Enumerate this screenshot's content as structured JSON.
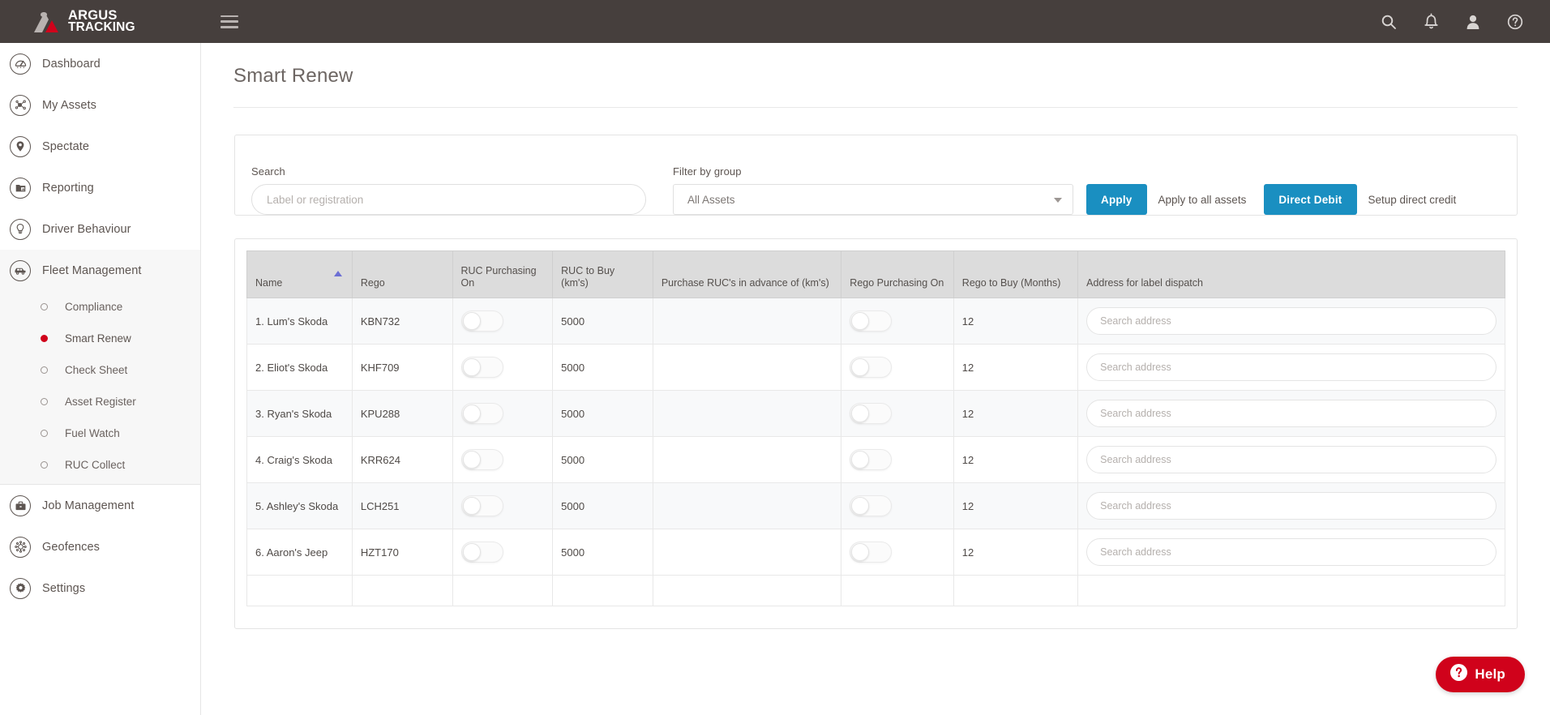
{
  "brand": {
    "name_line1": "ARGUS",
    "name_line2": "TRACKING",
    "red": "#d0021b",
    "gray": "#b8b2b0",
    "header_bg": "#463f3d"
  },
  "topbar": {
    "hamburger_name": "menu-toggle",
    "icons": [
      {
        "name": "search-icon",
        "label": "Search"
      },
      {
        "name": "bell-icon",
        "label": "Notifications"
      },
      {
        "name": "user-icon",
        "label": "Account"
      },
      {
        "name": "help-circle-icon",
        "label": "Help"
      }
    ]
  },
  "sidebar": {
    "items": [
      {
        "label": "Dashboard",
        "icon": "dashboard-icon",
        "key": "dashboard"
      },
      {
        "label": "My Assets",
        "icon": "assets-icon",
        "key": "my-assets"
      },
      {
        "label": "Spectate",
        "icon": "map-pin-icon",
        "key": "spectate"
      },
      {
        "label": "Reporting",
        "icon": "report-icon",
        "key": "reporting"
      },
      {
        "label": "Driver Behaviour",
        "icon": "bulb-icon",
        "key": "driver-behaviour"
      },
      {
        "label": "Fleet Management",
        "icon": "truck-icon",
        "key": "fleet-management"
      }
    ],
    "fleet_sub_items": [
      {
        "label": "Compliance",
        "selected": false
      },
      {
        "label": "Smart Renew",
        "selected": true
      },
      {
        "label": "Check Sheet",
        "selected": false
      },
      {
        "label": "Asset Register",
        "selected": false
      },
      {
        "label": "Fuel Watch",
        "selected": false
      },
      {
        "label": "RUC Collect",
        "selected": false
      }
    ],
    "bottom_items": [
      {
        "label": "Job Management",
        "icon": "briefcase-icon",
        "key": "job-management"
      },
      {
        "label": "Geofences",
        "icon": "geofence-icon",
        "key": "geofences"
      },
      {
        "label": "Settings",
        "icon": "gear-icon",
        "key": "settings"
      }
    ]
  },
  "page": {
    "title": "Smart Renew"
  },
  "filters": {
    "search_label": "Search",
    "search_placeholder": "Label or registration",
    "search_value": "",
    "group_label": "Filter by group",
    "group_value": "All Assets",
    "apply_button": "Apply",
    "apply_hint": "Apply to all assets",
    "direct_debit_button": "Direct Debit",
    "direct_debit_hint": "Setup direct credit",
    "accent": "#1a8fc1"
  },
  "table": {
    "columns": [
      "Name",
      "Rego",
      "RUC Purchasing On",
      "RUC to Buy (km's)",
      "Purchase RUC's in advance of (km's)",
      "Rego Purchasing On",
      "Rego to Buy (Months)",
      "Address for label dispatch"
    ],
    "sort_column": "Name",
    "sort_direction": "asc",
    "address_placeholder": "Search address",
    "rows": [
      {
        "name": "1. Lum's Skoda",
        "rego": "KBN732",
        "ruc_purchasing_on": false,
        "ruc_to_buy": "5000",
        "ruc_advance": "",
        "rego_purchasing_on": false,
        "rego_to_buy": "12",
        "address": ""
      },
      {
        "name": "2. Eliot's Skoda",
        "rego": "KHF709",
        "ruc_purchasing_on": false,
        "ruc_to_buy": "5000",
        "ruc_advance": "",
        "rego_purchasing_on": false,
        "rego_to_buy": "12",
        "address": ""
      },
      {
        "name": "3. Ryan's Skoda",
        "rego": "KPU288",
        "ruc_purchasing_on": false,
        "ruc_to_buy": "5000",
        "ruc_advance": "",
        "rego_purchasing_on": false,
        "rego_to_buy": "12",
        "address": ""
      },
      {
        "name": "4. Craig's Skoda",
        "rego": "KRR624",
        "ruc_purchasing_on": false,
        "ruc_to_buy": "5000",
        "ruc_advance": "",
        "rego_purchasing_on": false,
        "rego_to_buy": "12",
        "address": ""
      },
      {
        "name": "5. Ashley's Skoda",
        "rego": "LCH251",
        "ruc_purchasing_on": false,
        "ruc_to_buy": "5000",
        "ruc_advance": "",
        "rego_purchasing_on": false,
        "rego_to_buy": "12",
        "address": ""
      },
      {
        "name": "6. Aaron's Jeep",
        "rego": "HZT170",
        "ruc_purchasing_on": false,
        "ruc_to_buy": "5000",
        "ruc_advance": "",
        "rego_purchasing_on": false,
        "rego_to_buy": "12",
        "address": ""
      }
    ]
  },
  "help_widget": {
    "label": "Help",
    "color": "#d0021b"
  }
}
